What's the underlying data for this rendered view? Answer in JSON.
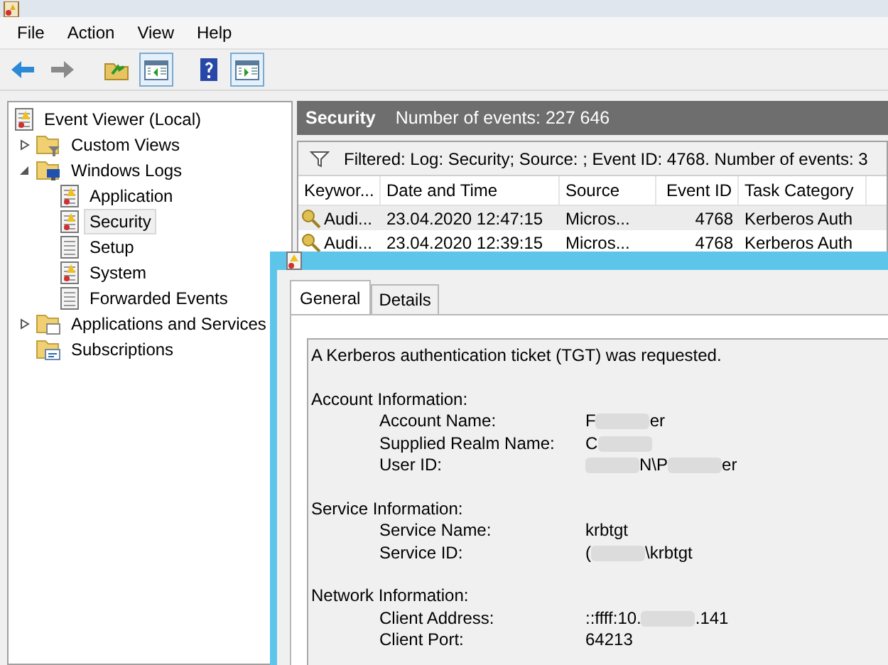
{
  "menu": [
    "File",
    "Action",
    "View",
    "Help"
  ],
  "toolbar": [
    {
      "pressed": false
    },
    {
      "pressed": false
    },
    {
      "pressed": false
    },
    {
      "pressed": true
    },
    {
      "pressed": false
    },
    {
      "pressed": true
    }
  ],
  "tree": [
    {
      "label": "Event Viewer (Local)",
      "kind": "root",
      "selected": false,
      "children": [
        {
          "label": "Custom Views",
          "kind": "filter",
          "expanded": false,
          "selected": false
        },
        {
          "label": "Windows Logs",
          "kind": "monitor",
          "expanded": true,
          "selected": false,
          "children": [
            {
              "label": "Application",
              "kind": "warning",
              "selected": false
            },
            {
              "label": "Security",
              "kind": "warning",
              "selected": true
            },
            {
              "label": "Setup",
              "kind": "plain",
              "selected": false
            },
            {
              "label": "System",
              "kind": "warning",
              "selected": false
            },
            {
              "label": "Forwarded Events",
              "kind": "plain",
              "selected": false
            }
          ]
        },
        {
          "label": "Applications and Services",
          "kind": "folder",
          "expanded": false,
          "selected": false
        },
        {
          "label": "Subscriptions",
          "kind": "subscription",
          "selected": false
        }
      ]
    }
  ],
  "header": {
    "title": "Security",
    "count": "Number of events: 227 646"
  },
  "filter": "Filtered: Log: Security; Source: ; Event ID: 4768. Number of events: 3",
  "table": {
    "columns": [
      "Keywor...",
      "Date and Time",
      "Source",
      "Event ID",
      "Task Category"
    ],
    "rows": [
      {
        "selected": true,
        "cells": [
          "Audi...",
          "23.04.2020 12:47:15",
          "Micros...",
          "4768",
          "Kerberos Auth"
        ]
      },
      {
        "selected": false,
        "cells": [
          "Audi...",
          "23.04.2020 12:39:15",
          "Micros...",
          "4768",
          "Kerberos Auth"
        ]
      }
    ]
  },
  "dialog": {
    "tabs": [
      {
        "label": "General",
        "selected": true
      },
      {
        "label": "Details",
        "selected": false
      }
    ],
    "summary": "A Kerberos authentication ticket (TGT) was requested.",
    "sections": [
      {
        "title": "Account Information:",
        "fields": [
          {
            "label": "Account Name:",
            "value": [
              {
                "kind": "text",
                "text": "F"
              },
              {
                "kind": "redacted"
              },
              {
                "kind": "text",
                "text": "er"
              }
            ]
          },
          {
            "label": "Supplied Realm Name:",
            "value": [
              {
                "kind": "text",
                "text": "C"
              },
              {
                "kind": "redacted"
              }
            ]
          },
          {
            "label": "User ID:",
            "value": [
              {
                "kind": "redacted"
              },
              {
                "kind": "text",
                "text": "N\\P"
              },
              {
                "kind": "redacted"
              },
              {
                "kind": "text",
                "text": "er"
              }
            ]
          }
        ]
      },
      {
        "title": "Service Information:",
        "fields": [
          {
            "label": "Service Name:",
            "value": [
              {
                "kind": "text",
                "text": "krbtgt"
              }
            ]
          },
          {
            "label": "Service ID:",
            "value": [
              {
                "kind": "text",
                "text": "("
              },
              {
                "kind": "redacted"
              },
              {
                "kind": "text",
                "text": "\\krbtgt"
              }
            ]
          }
        ]
      },
      {
        "title": "Network Information:",
        "fields": [
          {
            "label": "Client Address:",
            "value": [
              {
                "kind": "text",
                "text": "::ffff:10."
              },
              {
                "kind": "redacted"
              },
              {
                "kind": "text",
                "text": ".141"
              }
            ]
          },
          {
            "label": "Client Port:",
            "value": [
              {
                "kind": "text",
                "text": "64213"
              }
            ]
          }
        ]
      }
    ]
  }
}
